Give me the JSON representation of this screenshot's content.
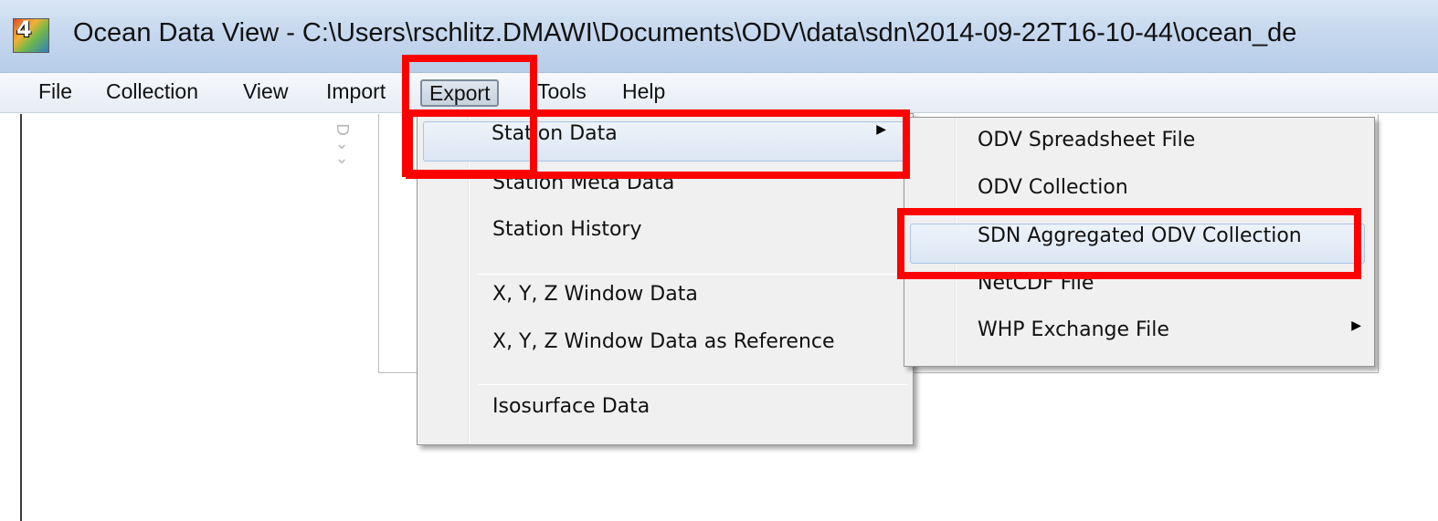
{
  "window": {
    "title": "Ocean Data View - C:\\Users\\rschlitz.DMAWI\\Documents\\ODV\\data\\sdn\\2014-09-22T16-10-44\\ocean_de",
    "icon_number": "4",
    "icon": "odv-app-icon"
  },
  "menubar": {
    "items": [
      {
        "label": "File"
      },
      {
        "label": "Collection"
      },
      {
        "label": "View"
      },
      {
        "label": "Import"
      },
      {
        "label": "Export"
      },
      {
        "label": "Tools"
      },
      {
        "label": "Help"
      }
    ],
    "active": "Export"
  },
  "export_menu": {
    "items": [
      {
        "label": "Station Data",
        "submenu": true
      },
      {
        "label": "Station Meta Data"
      },
      {
        "label": "Station History"
      },
      {
        "label": "X, Y, Z Window Data"
      },
      {
        "label": "X, Y, Z Window Data as Reference"
      },
      {
        "label": "Isosurface Data"
      }
    ],
    "highlighted": "Station Data"
  },
  "station_data_submenu": {
    "items": [
      {
        "label": "ODV Spreadsheet File"
      },
      {
        "label": "ODV Collection"
      },
      {
        "label": "SDN Aggregated ODV Collection"
      },
      {
        "label": "NetCDF File"
      },
      {
        "label": "WHP Exchange File",
        "submenu": true
      }
    ],
    "highlighted": "SDN Aggregated ODV Collection"
  },
  "annotation_color": "#ff0000",
  "ghost_glyphs": "D\n>\n>"
}
